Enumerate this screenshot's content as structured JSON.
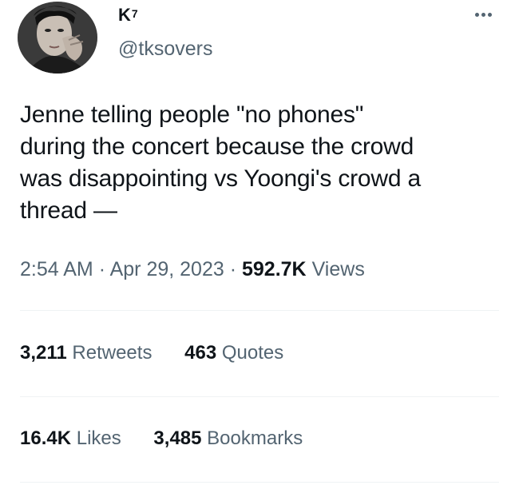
{
  "user": {
    "display_name": "K",
    "display_name_superscript": "7",
    "handle": "@tksovers"
  },
  "tweet": {
    "text_lines": [
      "Jenne telling people \"no phones\"",
      "during the concert because the crowd",
      "was disappointing vs Yoongi's crowd a",
      "thread —"
    ]
  },
  "meta": {
    "time": "2:54 AM",
    "separator": "·",
    "date": "Apr 29, 2023",
    "views_count": "592.7K",
    "views_label": "Views"
  },
  "stats": {
    "retweets_count": "3,211",
    "retweets_label": "Retweets",
    "quotes_count": "463",
    "quotes_label": "Quotes",
    "likes_count": "16.4K",
    "likes_label": "Likes",
    "bookmarks_count": "3,485",
    "bookmarks_label": "Bookmarks"
  },
  "icons": {
    "more": "more-horizontal-icon"
  },
  "colors": {
    "primary_text": "#0f1419",
    "secondary_text": "#536471",
    "divider": "#eff3f4"
  }
}
